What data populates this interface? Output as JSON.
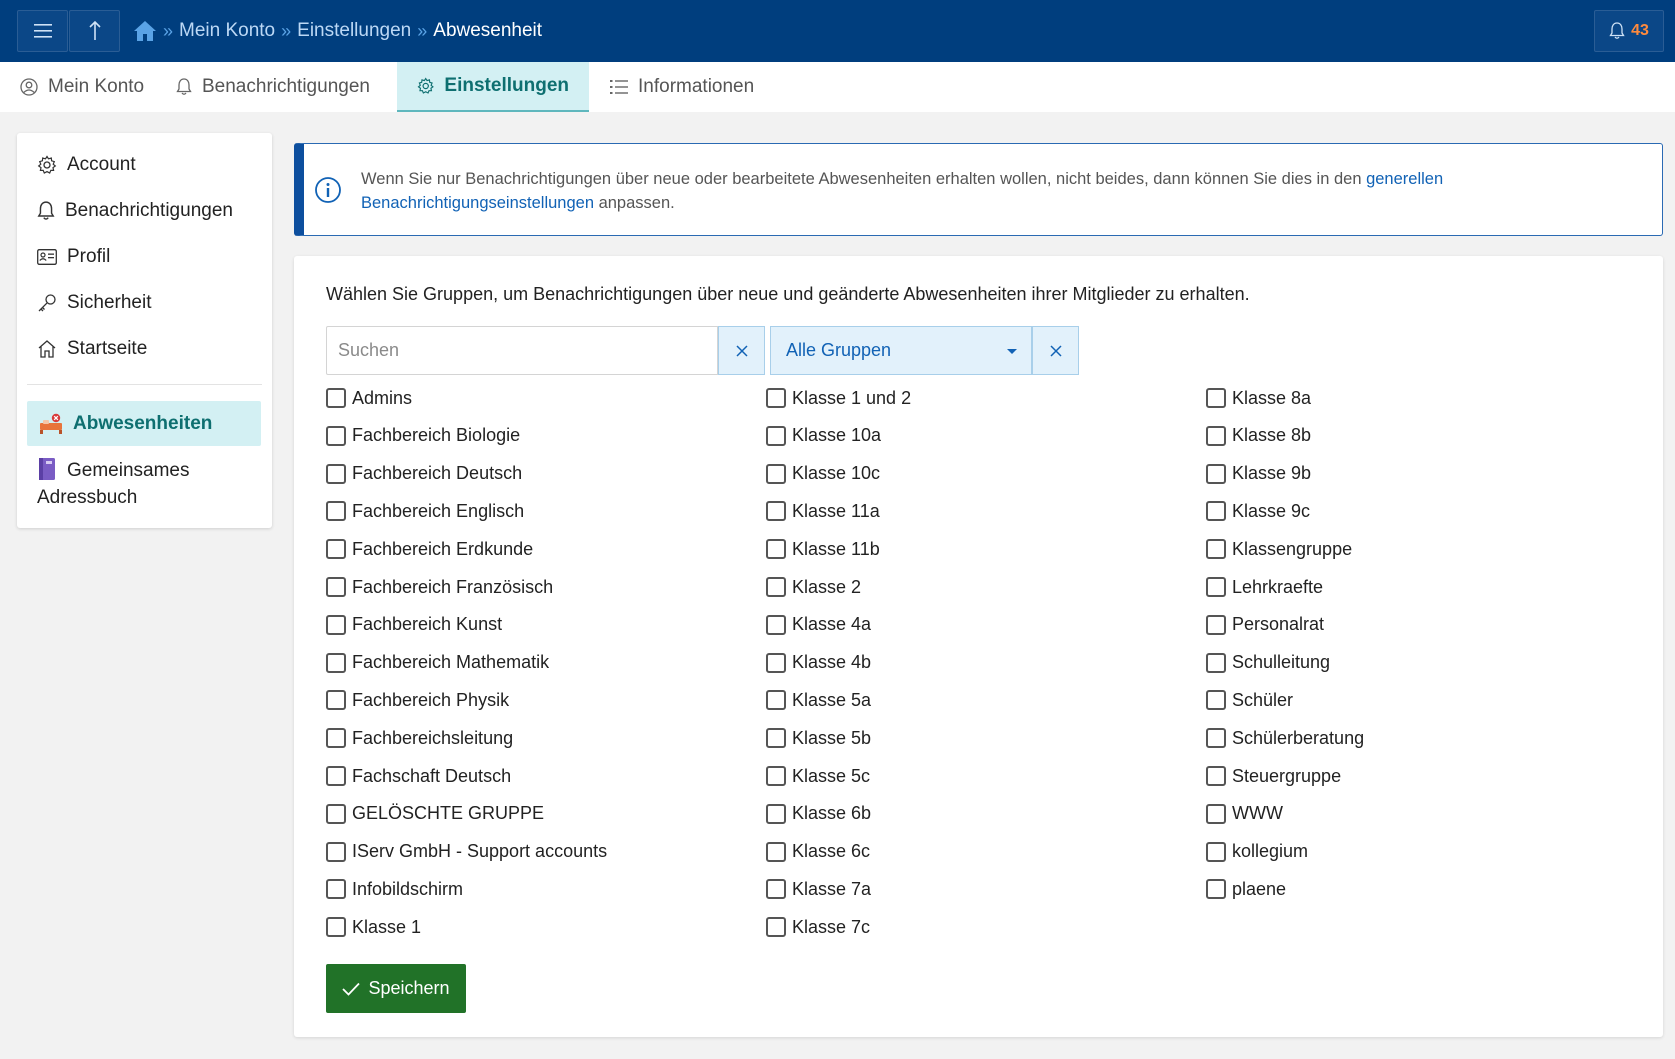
{
  "breadcrumb": {
    "items": [
      "Mein Konto",
      "Einstellungen"
    ],
    "current": "Abwesenheit"
  },
  "notifications": {
    "count": "43"
  },
  "tabs": [
    {
      "label": "Mein Konto",
      "icon": "user-circle-icon"
    },
    {
      "label": "Benachrichtigungen",
      "icon": "bell-icon"
    },
    {
      "label": "Einstellungen",
      "icon": "gear-icon",
      "active": true
    },
    {
      "label": "Informationen",
      "icon": "list-icon"
    }
  ],
  "sidebar": {
    "items": [
      {
        "label": "Account",
        "icon": "gear-icon"
      },
      {
        "label": "Benachrichtigungen",
        "icon": "bell-icon"
      },
      {
        "label": "Profil",
        "icon": "id-card-icon"
      },
      {
        "label": "Sicherheit",
        "icon": "key-icon"
      },
      {
        "label": "Startseite",
        "icon": "home-icon"
      }
    ],
    "modules": [
      {
        "label": "Abwesenheiten",
        "icon": "absence-bed-icon",
        "active": true
      },
      {
        "label": "Gemeinsames Adressbuch",
        "icon": "address-book-icon"
      }
    ]
  },
  "info": {
    "text_before": "Wenn Sie nur Benachrichtigungen über neue oder bearbeitete Abwesenheiten erhalten wollen, nicht beides, dann können Sie dies in den ",
    "link": "generellen Benachrichtigungseinstellungen",
    "text_after": " anpassen."
  },
  "main": {
    "intro": "Wählen Sie Gruppen, um Benachrichtigungen über neue und geänderte Abwesenheiten ihrer Mitglieder zu erhalten.",
    "search_placeholder": "Suchen",
    "search_value": "",
    "filter_selected": "Alle Gruppen",
    "groups_col1": [
      "Admins",
      "Fachbereich Biologie",
      "Fachbereich Deutsch",
      "Fachbereich Englisch",
      "Fachbereich Erdkunde",
      "Fachbereich Französisch",
      "Fachbereich Kunst",
      "Fachbereich Mathematik",
      "Fachbereich Physik",
      "Fachbereichsleitung",
      "Fachschaft Deutsch",
      "GELÖSCHTE GRUPPE",
      "IServ GmbH - Support accounts",
      "Infobildschirm",
      "Klasse 1"
    ],
    "groups_col2": [
      "Klasse 1 und 2",
      "Klasse 10a",
      "Klasse 10c",
      "Klasse 11a",
      "Klasse 11b",
      "Klasse 2",
      "Klasse 4a",
      "Klasse 4b",
      "Klasse 5a",
      "Klasse 5b",
      "Klasse 5c",
      "Klasse 6b",
      "Klasse 6c",
      "Klasse 7a",
      "Klasse 7c"
    ],
    "groups_col3": [
      "Klasse 8a",
      "Klasse 8b",
      "Klasse 9b",
      "Klasse 9c",
      "Klassengruppe",
      "Lehrkraefte",
      "Personalrat",
      "Schulleitung",
      "Schüler",
      "Schülerberatung",
      "Steuergruppe",
      "WWW",
      "kollegium",
      "plaene"
    ],
    "save_label": "Speichern"
  },
  "colors": {
    "topbar": "#003e7e",
    "accent": "#0e6f70",
    "link": "#1162b5",
    "save": "#217228",
    "badge": "#ff8a3d"
  }
}
